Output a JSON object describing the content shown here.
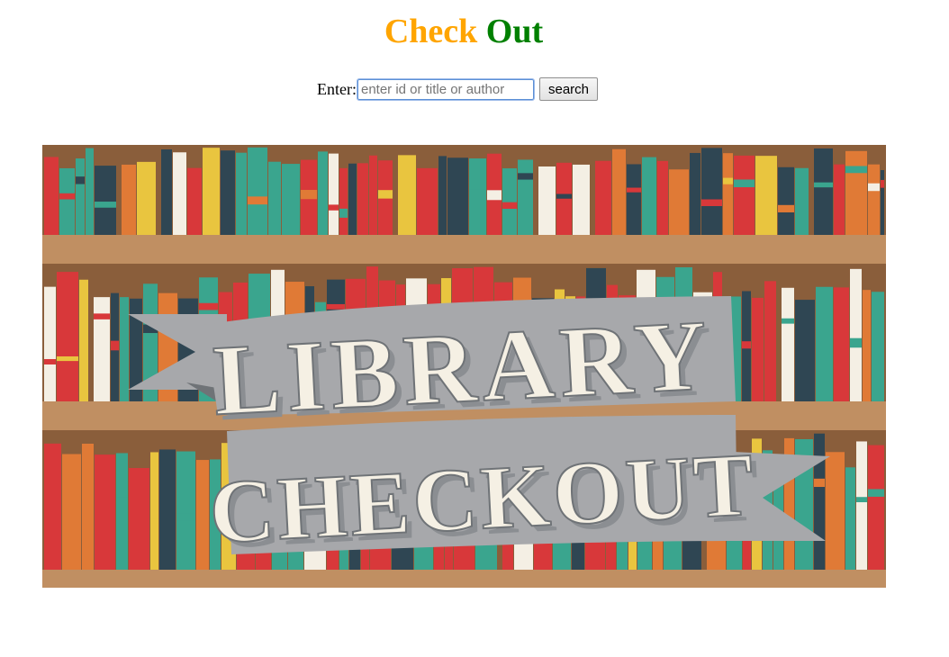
{
  "header": {
    "title_word_1": "Check",
    "title_word_2": "Out",
    "title_word_1_color": "#ffa500",
    "title_word_2_color": "#008000"
  },
  "search": {
    "label": "Enter:",
    "value": "",
    "placeholder": "enter id or title or author",
    "button_label": "search"
  },
  "banner": {
    "line_1": "LIBRARY",
    "line_2": "CHECKOUT",
    "colors": {
      "wood": "#8a5e3b",
      "shelf": "#c08f62",
      "ribbon": "#a7a8ab",
      "ribbon_dark": "#6f7377",
      "lettering": "#f5f0e4",
      "book_red": "#d8383a",
      "book_teal": "#3aa58e",
      "book_yellow": "#e9c53f",
      "book_navy": "#2f4653",
      "book_orange": "#e07a36",
      "book_cream": "#f4efe4"
    }
  }
}
